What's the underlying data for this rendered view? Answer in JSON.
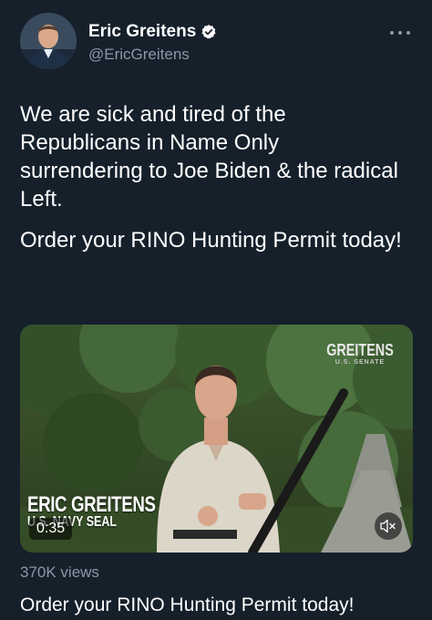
{
  "author": {
    "name": "Eric Greitens",
    "handle": "@EricGreitens",
    "verified": true
  },
  "tweet": {
    "paragraphs": [
      "We are sick and tired of the Republicans in Name Only surrendering to Joe Biden & the radical Left.",
      "Order your RINO Hunting Permit today!"
    ]
  },
  "video": {
    "brand_logo": "GREITENS",
    "brand_subtitle": "U.S. SENATE",
    "lower_third_name": "ERIC GREITENS",
    "lower_third_title": "U.S. NAVY SEAL",
    "duration": "0:35",
    "muted": true
  },
  "stats": {
    "views": "370K views"
  },
  "card_title": "Order your RINO Hunting Permit today!",
  "colors": {
    "background": "#15202b",
    "secondary_text": "#8b98a5",
    "verified_badge": "#ffffff"
  },
  "icons": [
    "verified-icon",
    "more-icon",
    "mute-icon"
  ]
}
